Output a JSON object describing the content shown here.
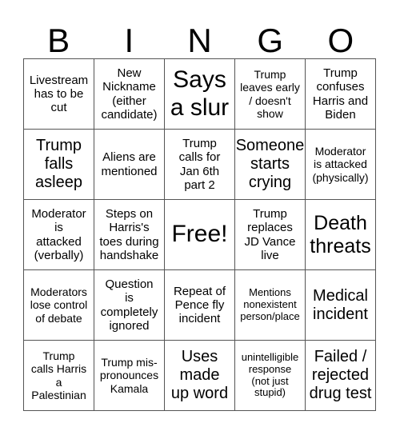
{
  "header": {
    "letters": [
      "B",
      "I",
      "N",
      "G",
      "O"
    ]
  },
  "board": {
    "rows": [
      [
        {
          "text": "Livestream\nhas to be\ncut",
          "size": "s-md"
        },
        {
          "text": "New\nNickname\n(either\ncandidate)",
          "size": "s-md"
        },
        {
          "text": "Says\na slur",
          "size": "s-xxl"
        },
        {
          "text": "Trump\nleaves early\n/ doesn't\nshow",
          "size": "s-sm"
        },
        {
          "text": "Trump\nconfuses\nHarris and\nBiden",
          "size": "s-md"
        }
      ],
      [
        {
          "text": "Trump\nfalls\nasleep",
          "size": "s-lg"
        },
        {
          "text": "Aliens are\nmentioned",
          "size": "s-md"
        },
        {
          "text": "Trump\ncalls for\nJan 6th\npart 2",
          "size": "s-md"
        },
        {
          "text": "Someone\nstarts\ncrying",
          "size": "s-lg"
        },
        {
          "text": "Moderator\nis attacked\n(physically)",
          "size": "s-sm"
        }
      ],
      [
        {
          "text": "Moderator\nis\nattacked\n(verbally)",
          "size": "s-md"
        },
        {
          "text": "Steps on\nHarris's\ntoes during\nhandshake",
          "size": "s-md"
        },
        {
          "text": "Free!",
          "size": "s-xxl"
        },
        {
          "text": "Trump\nreplaces\nJD Vance\nlive",
          "size": "s-md"
        },
        {
          "text": "Death\nthreats",
          "size": "s-xl"
        }
      ],
      [
        {
          "text": "Moderators\nlose control\nof debate",
          "size": "s-sm"
        },
        {
          "text": "Question\nis\ncompletely\nignored",
          "size": "s-md"
        },
        {
          "text": "Repeat of\nPence fly\nincident",
          "size": "s-md"
        },
        {
          "text": "Mentions\nnonexistent\nperson/place",
          "size": "s-xs"
        },
        {
          "text": "Medical\nincident",
          "size": "s-lg"
        }
      ],
      [
        {
          "text": "Trump\ncalls Harris\na\nPalestinian",
          "size": "s-sm"
        },
        {
          "text": "Trump mis-\npronounces\nKamala",
          "size": "s-sm"
        },
        {
          "text": "Uses\nmade\nup word",
          "size": "s-lg"
        },
        {
          "text": "unintelligible\nresponse\n(not just\nstupid)",
          "size": "s-xs"
        },
        {
          "text": "Failed /\nrejected\ndrug test",
          "size": "s-lg"
        }
      ]
    ]
  }
}
